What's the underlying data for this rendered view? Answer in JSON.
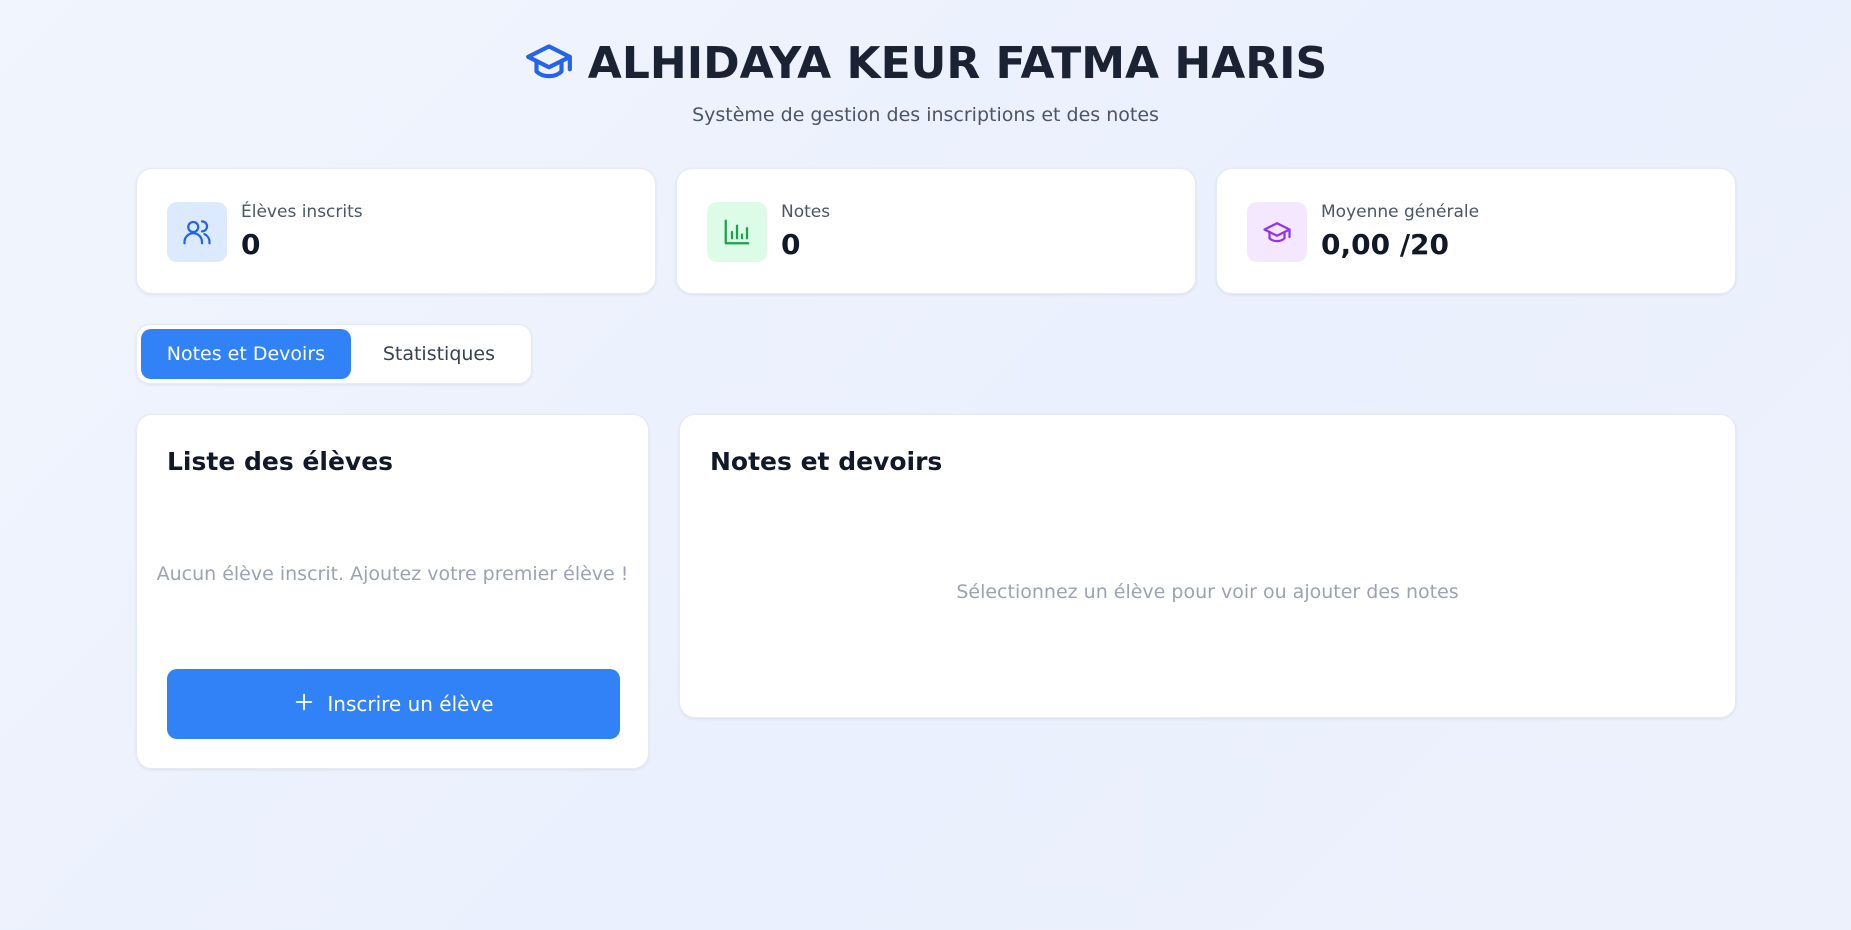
{
  "header": {
    "title": "ALHIDAYA KEUR FATMA HARIS",
    "subtitle": "Système de gestion des inscriptions et des notes",
    "icon": "graduation-cap-icon"
  },
  "stats": [
    {
      "label": "Élèves inscrits",
      "value": "0",
      "icon": "users-icon",
      "icon_bg": "#dbeafe",
      "icon_color": "#2563eb"
    },
    {
      "label": "Notes",
      "value": "0",
      "icon": "bar-chart-icon",
      "icon_bg": "#dcfce7",
      "icon_color": "#16a34a"
    },
    {
      "label": "Moyenne générale",
      "value": "0,00 /20",
      "icon": "graduation-cap-icon",
      "icon_bg": "#f3e8ff",
      "icon_color": "#9333ea"
    }
  ],
  "tabs": [
    {
      "label": "Notes et Devoirs",
      "active": true
    },
    {
      "label": "Statistiques",
      "active": false
    }
  ],
  "students_panel": {
    "title": "Liste des élèves",
    "empty_message": "Aucun élève inscrit. Ajoutez votre premier élève !",
    "add_button_label": "Inscrire un élève"
  },
  "notes_panel": {
    "title": "Notes et devoirs",
    "empty_message": "Sélectionnez un élève pour voir ou ajouter des notes"
  },
  "colors": {
    "accent": "#3182f6",
    "title_icon": "#2563eb"
  }
}
